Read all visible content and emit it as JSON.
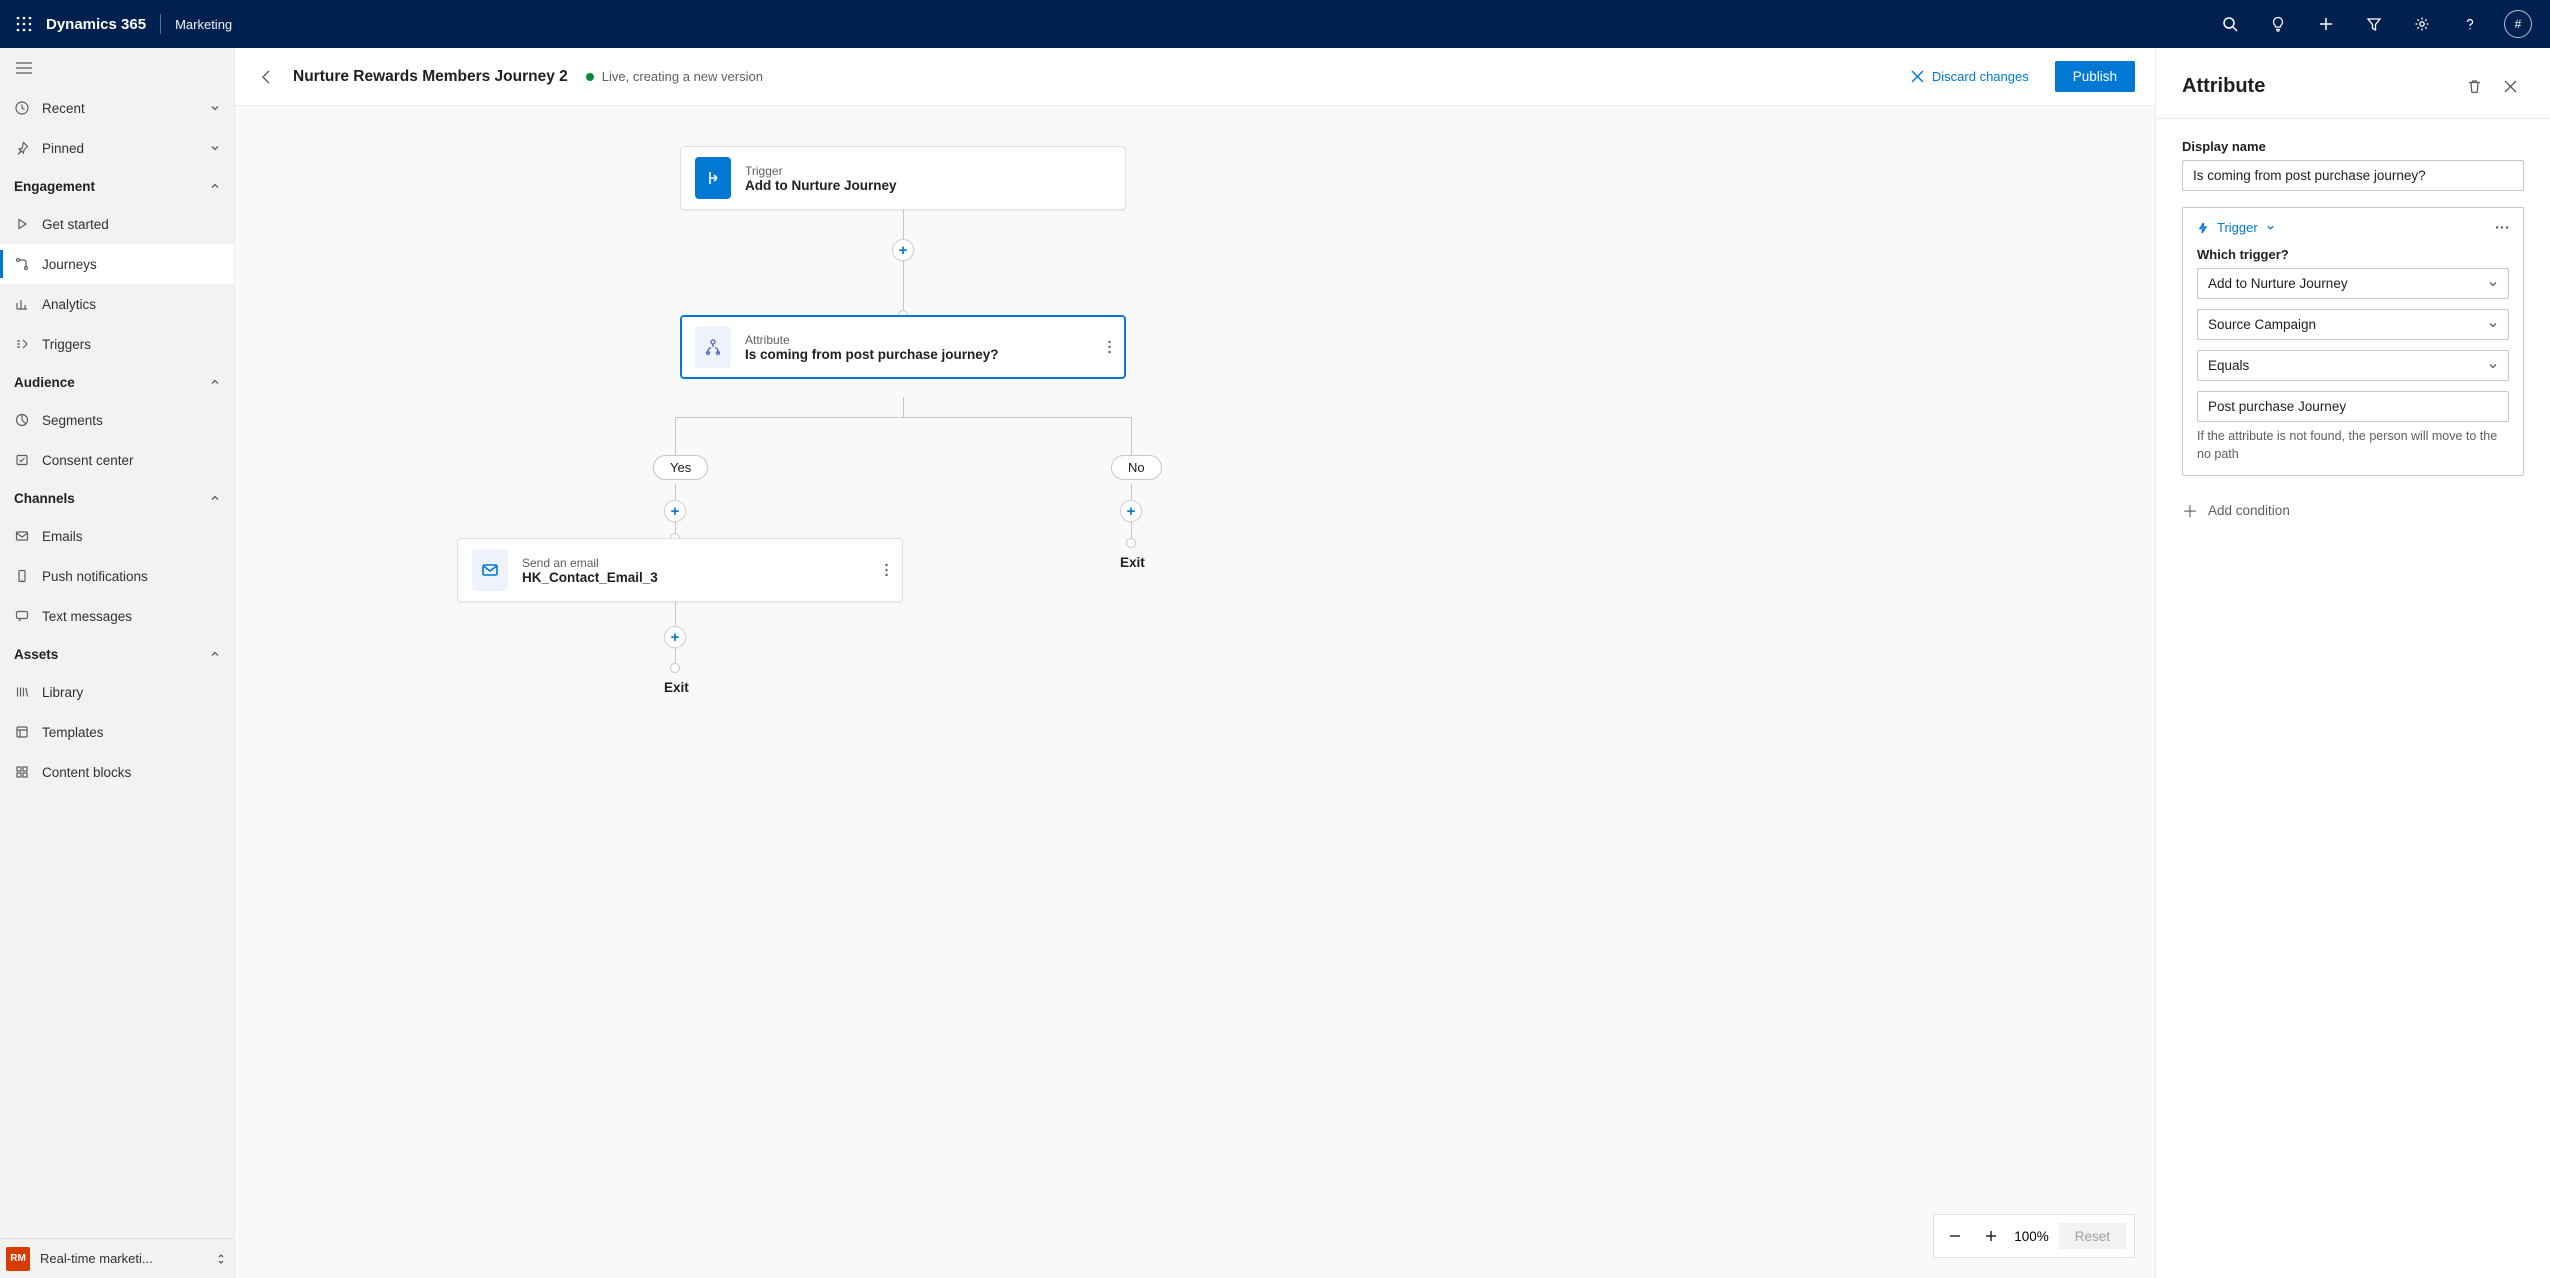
{
  "topbar": {
    "brand": "Dynamics 365",
    "sub_app": "Marketing",
    "avatar_initial": "#"
  },
  "sidebar": {
    "recent": "Recent",
    "pinned": "Pinned",
    "groups": {
      "engagement": "Engagement",
      "audience": "Audience",
      "channels": "Channels",
      "assets": "Assets"
    },
    "items": {
      "get_started": "Get started",
      "journeys": "Journeys",
      "analytics": "Analytics",
      "triggers": "Triggers",
      "segments": "Segments",
      "consent_center": "Consent center",
      "emails": "Emails",
      "push_notifications": "Push notifications",
      "text_messages": "Text messages",
      "library": "Library",
      "templates": "Templates",
      "content_blocks": "Content blocks"
    },
    "area_switcher": {
      "badge": "RM",
      "label": "Real-time marketi..."
    }
  },
  "commandbar": {
    "title": "Nurture Rewards Members Journey 2",
    "status": "Live, creating a new version",
    "discard": "Discard changes",
    "publish": "Publish"
  },
  "canvas": {
    "trigger": {
      "sup": "Trigger",
      "main": "Add to Nurture Journey"
    },
    "attribute": {
      "sup": "Attribute",
      "main": "Is coming from post purchase journey?"
    },
    "branches": {
      "yes": "Yes",
      "no": "No"
    },
    "email": {
      "sup": "Send an email",
      "main": "HK_Contact_Email_3"
    },
    "exit_label_left": "Exit",
    "exit_label_right": "Exit",
    "zoom": {
      "level": "100%",
      "reset": "Reset"
    }
  },
  "panel": {
    "heading": "Attribute",
    "display_name_label": "Display name",
    "display_name_value": "Is coming from post purchase journey?",
    "condition": {
      "trigger_chip": "Trigger",
      "which_trigger_label": "Which trigger?",
      "trigger_value": "Add to Nurture Journey",
      "attribute_value": "Source Campaign",
      "operator_value": "Equals",
      "match_value": "Post purchase Journey",
      "helper": "If the attribute is not found, the person will move to the no path"
    },
    "add_condition": "Add condition"
  }
}
